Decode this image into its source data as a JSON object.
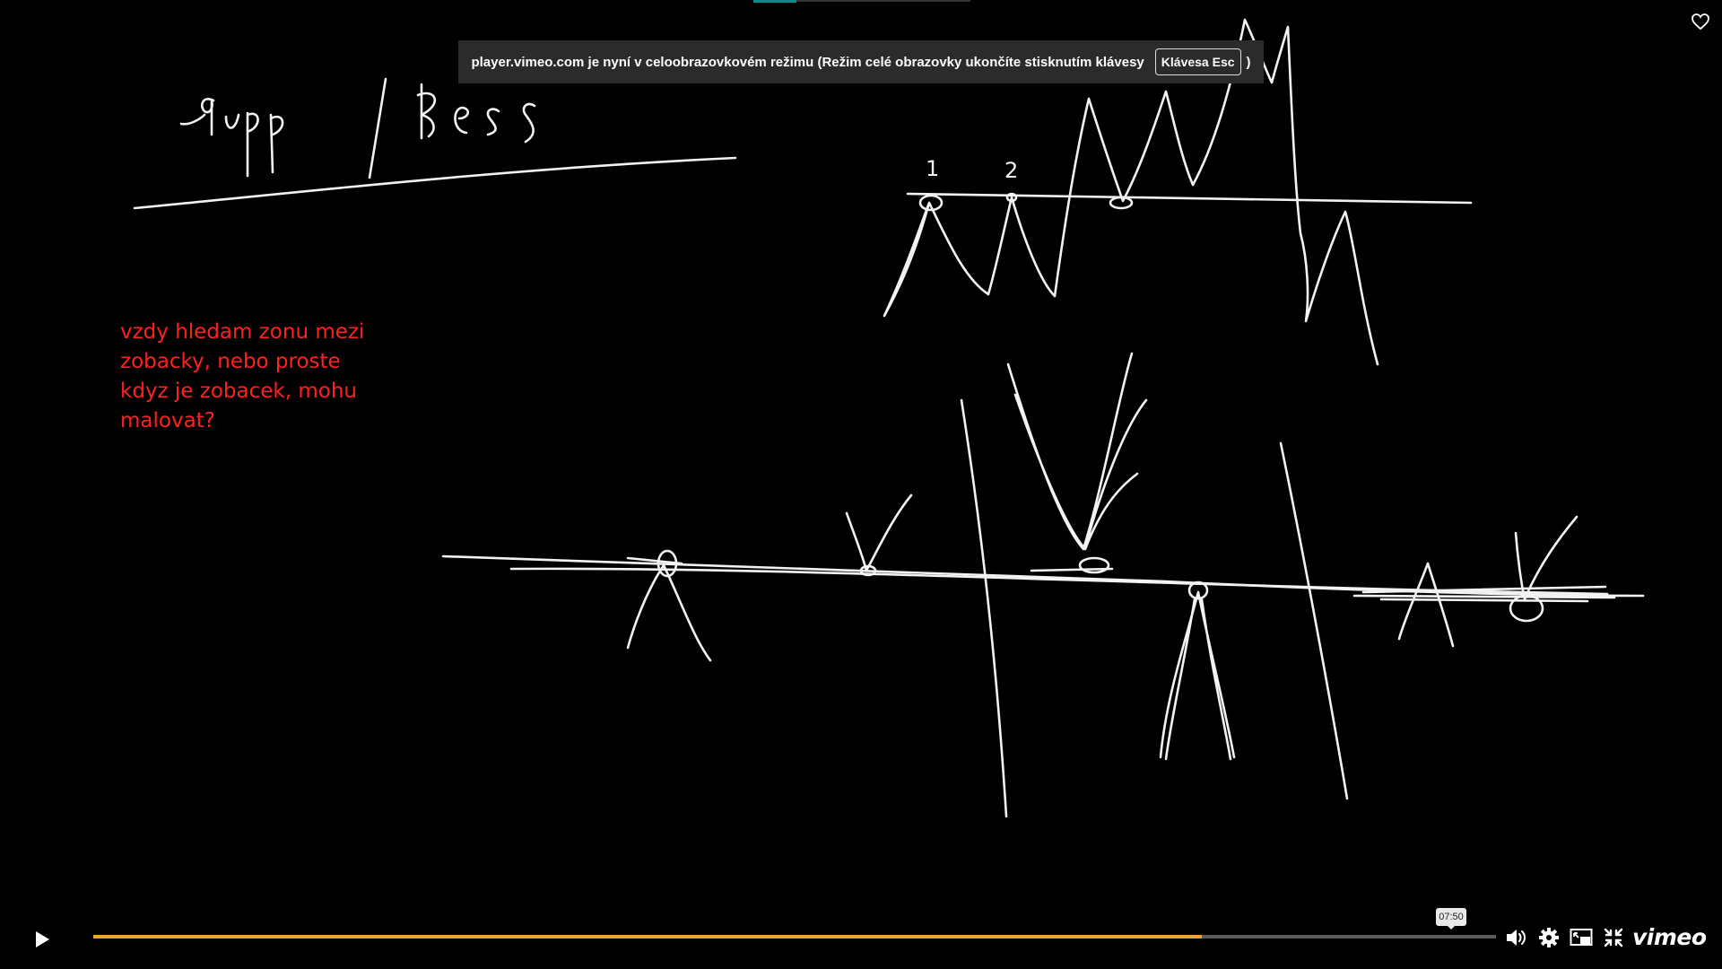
{
  "banner": {
    "message": "player.vimeo.com je nyní v celoobrazovkovém režimu (Režim celé obrazovky ukončíte stisknutím klávesy",
    "key_label": "Klávesa Esc",
    "closing": ")"
  },
  "whiteboard": {
    "title_strokes": "Supp / Ress",
    "label_1": "1",
    "label_2": "2"
  },
  "note": {
    "text": "vzdy hledam zonu mezi zobacky, nebo proste kdyz je zobacek, mohu malovat?",
    "color": "#ff2020"
  },
  "player": {
    "progress_fraction": 0.79,
    "time_tooltip": "07:50",
    "logo": "vimeo",
    "accent_color": "#e8a530",
    "icons": [
      "play-icon",
      "volume-icon",
      "gear-icon",
      "picture-in-picture-icon",
      "exit-fullscreen-icon",
      "heart-icon"
    ]
  }
}
